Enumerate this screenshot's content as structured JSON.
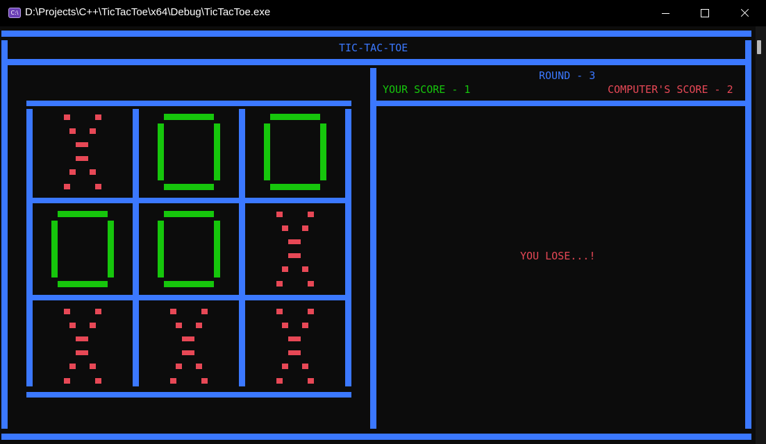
{
  "window": {
    "title": "D:\\Projects\\C++\\TicTacToe\\x64\\Debug\\TicTacToe.exe",
    "icon": "console-app-icon",
    "icon_text": "C:\\"
  },
  "game": {
    "title": "TIC-TAC-TOE",
    "round_label": "ROUND - 3",
    "your_score_label": "YOUR SCORE - 1",
    "computer_score_label": "COMPUTER'S SCORE - 2",
    "result_message": "YOU LOSE...!",
    "board": [
      "X",
      "O",
      "O",
      "O",
      "O",
      "X",
      "X",
      "X",
      "X"
    ]
  },
  "colors": {
    "border": "#3b78ff",
    "x_mark": "#e74856",
    "o_mark": "#16c60c",
    "background": "#0c0c0c"
  }
}
